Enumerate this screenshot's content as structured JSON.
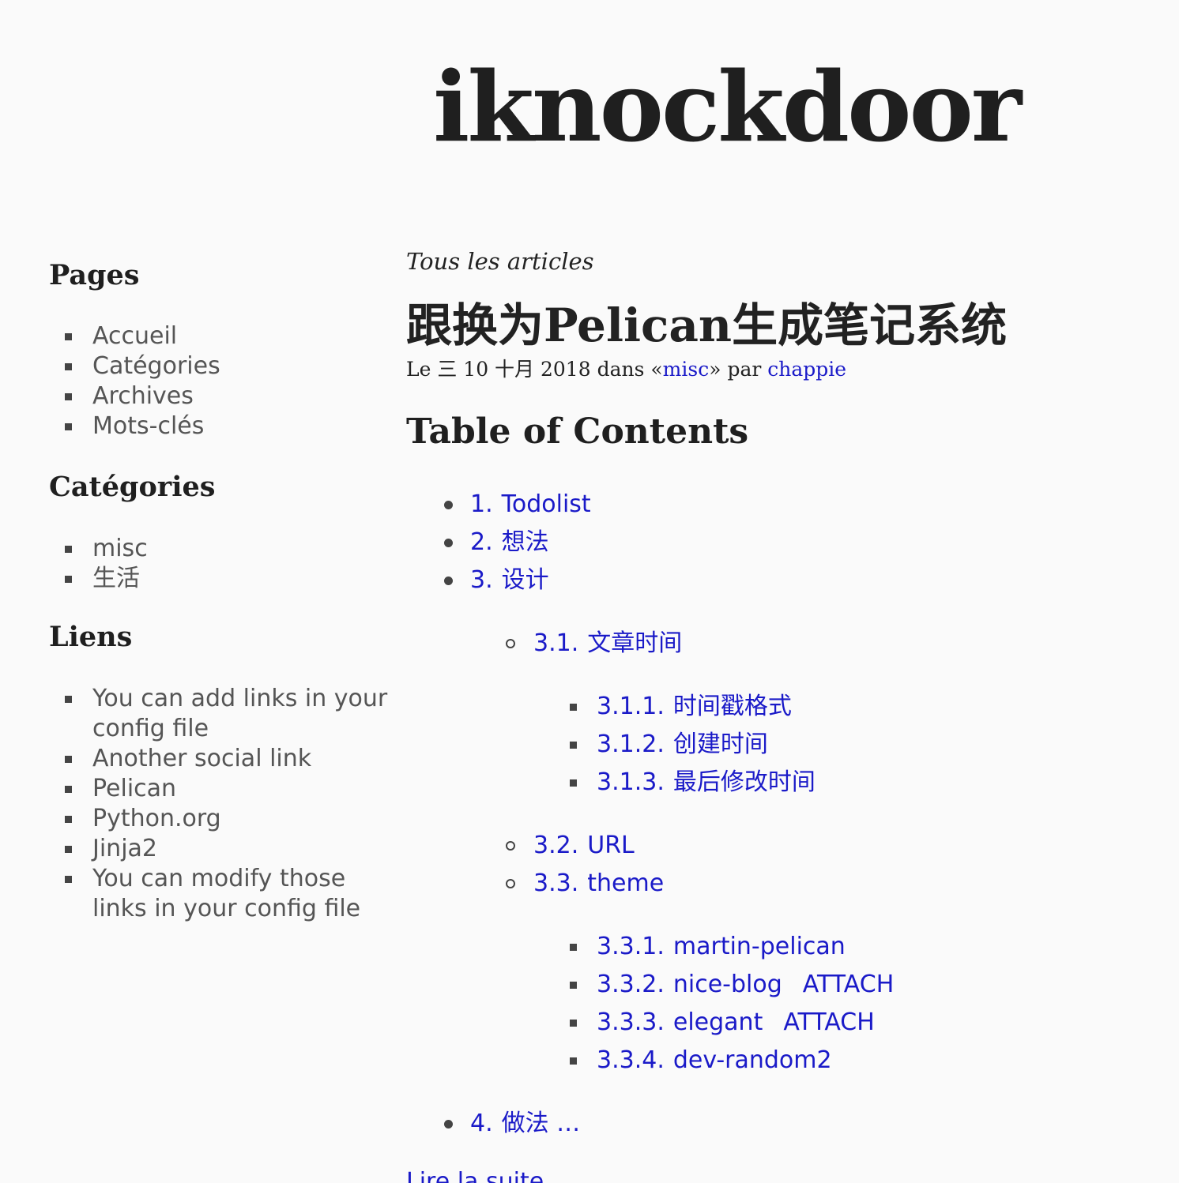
{
  "site": {
    "title": "iknockdoor"
  },
  "sidebar": {
    "pages": {
      "heading": "Pages",
      "items": [
        "Accueil",
        "Catégories",
        "Archives",
        "Mots-clés"
      ]
    },
    "categories": {
      "heading": "Catégories",
      "items": [
        "misc",
        "生活"
      ]
    },
    "links": {
      "heading": "Liens",
      "items": [
        "You can add links in your config file",
        "Another social link",
        "Pelican",
        "Python.org",
        "Jinja2",
        "You can modify those links in your config file"
      ]
    }
  },
  "main": {
    "all_articles": "Tous les articles",
    "article": {
      "title": "跟换为Pelican生成笔记系统",
      "meta": {
        "prefix": "Le 三 10 十月 2018 dans «",
        "category": "misc",
        "middle": "» par ",
        "author": "chappie"
      },
      "toc": {
        "heading": "Table of Contents",
        "items": [
          {
            "num": "1.",
            "label": "Todolist"
          },
          {
            "num": "2.",
            "label": "想法"
          },
          {
            "num": "3.",
            "label": "设计"
          },
          {
            "num": "3.1.",
            "label": "文章时间"
          },
          {
            "num": "3.1.1.",
            "label": "时间戳格式"
          },
          {
            "num": "3.1.2.",
            "label": "创建时间"
          },
          {
            "num": "3.1.3.",
            "label": "最后修改时间"
          },
          {
            "num": "3.2.",
            "label": "URL"
          },
          {
            "num": "3.3.",
            "label": "theme"
          },
          {
            "num": "3.3.1.",
            "label": "martin-pelican"
          },
          {
            "num": "3.3.2.",
            "label": "nice-blog",
            "tag": "ATTACH"
          },
          {
            "num": "3.3.3.",
            "label": "elegant",
            "tag": "ATTACH"
          },
          {
            "num": "3.3.4.",
            "label": "dev-random2"
          },
          {
            "num": "4.",
            "label": "做法 …"
          }
        ]
      },
      "read_more": "Lire la suite"
    }
  }
}
